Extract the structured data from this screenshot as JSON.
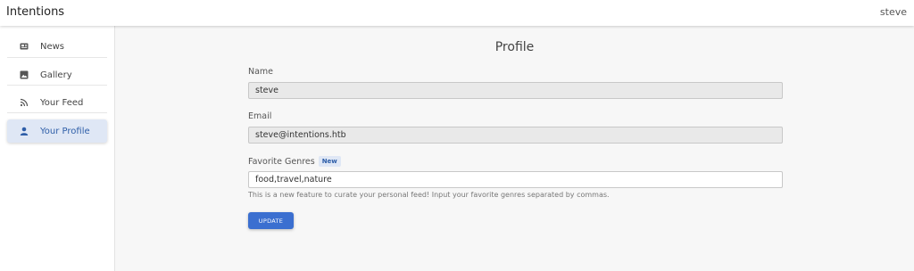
{
  "app": {
    "title": "Intentions",
    "username": "steve"
  },
  "sidebar": {
    "items": [
      {
        "label": "News",
        "icon": "newspaper-icon"
      },
      {
        "label": "Gallery",
        "icon": "image-icon"
      },
      {
        "label": "Your Feed",
        "icon": "rss-icon"
      },
      {
        "label": "Your Profile",
        "icon": "user-icon",
        "active": true
      }
    ]
  },
  "profile": {
    "title": "Profile",
    "name": {
      "label": "Name",
      "value": "steve"
    },
    "email": {
      "label": "Email",
      "value": "steve@intentions.htb"
    },
    "genres": {
      "label": "Favorite Genres",
      "badge": "New",
      "value": "food,travel,nature",
      "help": "This is a new feature to curate your personal feed! Input your favorite genres separated by commas."
    },
    "update_label": "UPDATE"
  },
  "colors": {
    "accent": "#3b6fd0",
    "active_bg": "#dfe7f5",
    "active_text": "#2e5ea8"
  }
}
